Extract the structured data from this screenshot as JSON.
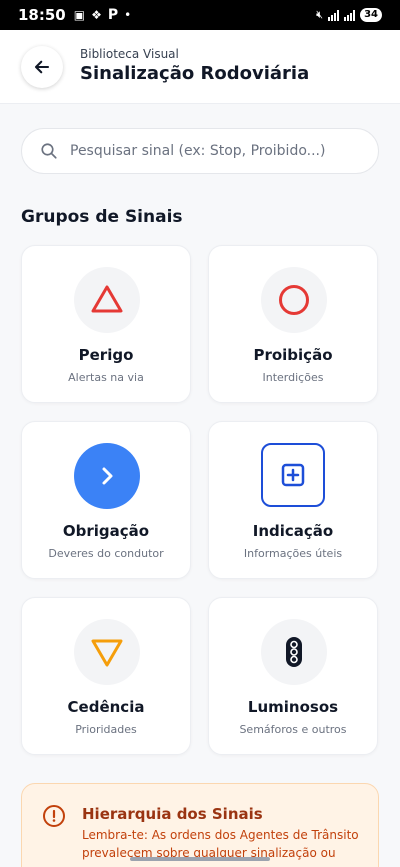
{
  "status_bar": {
    "time": "18:50",
    "battery": "34"
  },
  "header": {
    "subtitle": "Biblioteca Visual",
    "title": "Sinalização Rodoviária"
  },
  "search": {
    "placeholder": "Pesquisar sinal (ex: Stop, Proibido...)"
  },
  "section_title": "Grupos de Sinais",
  "groups": [
    {
      "title": "Perigo",
      "subtitle": "Alertas na via",
      "icon": "triangle-icon",
      "color": "#e53935"
    },
    {
      "title": "Proibição",
      "subtitle": "Interdições",
      "icon": "circle-icon",
      "color": "#e53935"
    },
    {
      "title": "Obrigação",
      "subtitle": "Deveres do condutor",
      "icon": "chevron-right-icon",
      "color": "#3b82f6"
    },
    {
      "title": "Indicação",
      "subtitle": "Informações úteis",
      "icon": "plus-square-icon",
      "color": "#1d4ed8"
    },
    {
      "title": "Cedência",
      "subtitle": "Prioridades",
      "icon": "inverted-triangle-icon",
      "color": "#f59e0b"
    },
    {
      "title": "Luminosos",
      "subtitle": "Semáforos e outros",
      "icon": "traffic-light-icon",
      "color": "#111827"
    }
  ],
  "alert": {
    "title": "Hierarquia dos Sinais",
    "text": "Lembra-te: As ordens dos Agentes de Trânsito prevalecem sobre qualquer sinalização ou",
    "color": "#c2410c"
  }
}
